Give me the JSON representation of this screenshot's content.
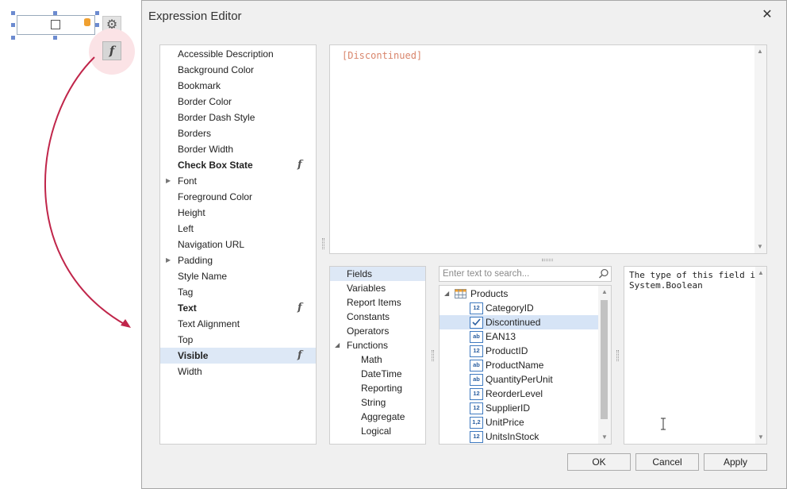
{
  "dialog": {
    "title": "Expression Editor",
    "close_glyph": "✕"
  },
  "designer": {
    "smart_tag_glyph": "⚙",
    "fx_glyph": "f",
    "arrow_color": "#c0254a"
  },
  "properties": [
    {
      "label": "Accessible Description",
      "bold": false,
      "fx": false,
      "expandable": false,
      "selected": false
    },
    {
      "label": "Background Color",
      "bold": false,
      "fx": false,
      "expandable": false,
      "selected": false
    },
    {
      "label": "Bookmark",
      "bold": false,
      "fx": false,
      "expandable": false,
      "selected": false
    },
    {
      "label": "Border Color",
      "bold": false,
      "fx": false,
      "expandable": false,
      "selected": false
    },
    {
      "label": "Border Dash Style",
      "bold": false,
      "fx": false,
      "expandable": false,
      "selected": false
    },
    {
      "label": "Borders",
      "bold": false,
      "fx": false,
      "expandable": false,
      "selected": false
    },
    {
      "label": "Border Width",
      "bold": false,
      "fx": false,
      "expandable": false,
      "selected": false
    },
    {
      "label": "Check Box State",
      "bold": true,
      "fx": true,
      "expandable": false,
      "selected": false
    },
    {
      "label": "Font",
      "bold": false,
      "fx": false,
      "expandable": true,
      "selected": false
    },
    {
      "label": "Foreground Color",
      "bold": false,
      "fx": false,
      "expandable": false,
      "selected": false
    },
    {
      "label": "Height",
      "bold": false,
      "fx": false,
      "expandable": false,
      "selected": false
    },
    {
      "label": "Left",
      "bold": false,
      "fx": false,
      "expandable": false,
      "selected": false
    },
    {
      "label": "Navigation URL",
      "bold": false,
      "fx": false,
      "expandable": false,
      "selected": false
    },
    {
      "label": "Padding",
      "bold": false,
      "fx": false,
      "expandable": true,
      "selected": false
    },
    {
      "label": "Style Name",
      "bold": false,
      "fx": false,
      "expandable": false,
      "selected": false
    },
    {
      "label": "Tag",
      "bold": false,
      "fx": false,
      "expandable": false,
      "selected": false
    },
    {
      "label": "Text",
      "bold": true,
      "fx": true,
      "expandable": false,
      "selected": false
    },
    {
      "label": "Text Alignment",
      "bold": false,
      "fx": false,
      "expandable": false,
      "selected": false
    },
    {
      "label": "Top",
      "bold": false,
      "fx": false,
      "expandable": false,
      "selected": false
    },
    {
      "label": "Visible",
      "bold": true,
      "fx": true,
      "expandable": false,
      "selected": true
    },
    {
      "label": "Width",
      "bold": false,
      "fx": false,
      "expandable": false,
      "selected": false
    }
  ],
  "fx_glyph": "f",
  "expression": {
    "value": "[Discontinued]"
  },
  "categories": [
    {
      "label": "Fields",
      "level": 0,
      "selected": true,
      "expanded": null
    },
    {
      "label": "Variables",
      "level": 0,
      "selected": false,
      "expanded": null
    },
    {
      "label": "Report Items",
      "level": 0,
      "selected": false,
      "expanded": null
    },
    {
      "label": "Constants",
      "level": 0,
      "selected": false,
      "expanded": null
    },
    {
      "label": "Operators",
      "level": 0,
      "selected": false,
      "expanded": null
    },
    {
      "label": "Functions",
      "level": 0,
      "selected": false,
      "expanded": true
    },
    {
      "label": "Math",
      "level": 1,
      "selected": false,
      "expanded": null
    },
    {
      "label": "DateTime",
      "level": 1,
      "selected": false,
      "expanded": null
    },
    {
      "label": "Reporting",
      "level": 1,
      "selected": false,
      "expanded": null
    },
    {
      "label": "String",
      "level": 1,
      "selected": false,
      "expanded": null
    },
    {
      "label": "Aggregate",
      "level": 1,
      "selected": false,
      "expanded": null
    },
    {
      "label": "Logical",
      "level": 1,
      "selected": false,
      "expanded": null
    }
  ],
  "search": {
    "placeholder": "Enter text to search..."
  },
  "fields_tree": {
    "root_label": "Products",
    "items": [
      {
        "label": "CategoryID",
        "icon": "12",
        "selected": false
      },
      {
        "label": "Discontinued",
        "icon": "check",
        "selected": true
      },
      {
        "label": "EAN13",
        "icon": "ab",
        "selected": false
      },
      {
        "label": "ProductID",
        "icon": "12",
        "selected": false
      },
      {
        "label": "ProductName",
        "icon": "ab",
        "selected": false
      },
      {
        "label": "QuantityPerUnit",
        "icon": "ab",
        "selected": false
      },
      {
        "label": "ReorderLevel",
        "icon": "12",
        "selected": false
      },
      {
        "label": "SupplierID",
        "icon": "12",
        "selected": false
      },
      {
        "label": "UnitPrice",
        "icon": "1,2",
        "selected": false
      },
      {
        "label": "UnitsInStock",
        "icon": "12",
        "selected": false
      }
    ]
  },
  "description": {
    "line1": "The type of this field is:",
    "line2": "System.Boolean"
  },
  "buttons": {
    "ok": "OK",
    "cancel": "Cancel",
    "apply": "Apply"
  },
  "scroll_arrows": {
    "up": "▲",
    "down": "▼"
  },
  "tree_arrows": {
    "collapsed": "▶",
    "expanded": "◢"
  },
  "colors": {
    "selection": "#dde8f6",
    "expression_text": "#d9856b",
    "field_icon_blue": "#3f7ac0"
  }
}
